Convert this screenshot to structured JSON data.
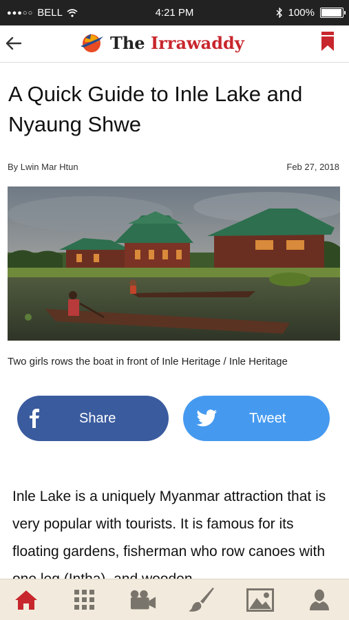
{
  "status_bar": {
    "carrier": "BELL",
    "time": "4:21 PM",
    "battery": "100%",
    "battery_level": 1.0
  },
  "header": {
    "brand_prefix": "The",
    "brand_name": "Irrawaddy"
  },
  "article": {
    "title": "A Quick Guide to Inle Lake and Nyaung Shwe",
    "byline": "By Lwin Mar Htun",
    "date": "Feb 27, 2018",
    "caption": "Two girls rows the boat in front of Inle Heritage / Inle Heritage",
    "body": "Inle Lake is a uniquely Myanmar attraction that is very popular with tourists. It is famous for its floating gardens, fisherman who row canoes with one leg (Intha), and wooden"
  },
  "share": {
    "facebook_label": "Share",
    "twitter_label": "Tweet"
  },
  "tabs": [
    {
      "icon": "home-icon",
      "active": true
    },
    {
      "icon": "grid-icon",
      "active": false
    },
    {
      "icon": "video-camera-icon",
      "active": false
    },
    {
      "icon": "paintbrush-icon",
      "active": false
    },
    {
      "icon": "photo-icon",
      "active": false
    },
    {
      "icon": "profile-icon",
      "active": false
    }
  ],
  "colors": {
    "brand_red": "#c8262d",
    "facebook": "#3a5b9e",
    "twitter": "#459af0",
    "tabbar_bg": "#f2ebdd"
  }
}
